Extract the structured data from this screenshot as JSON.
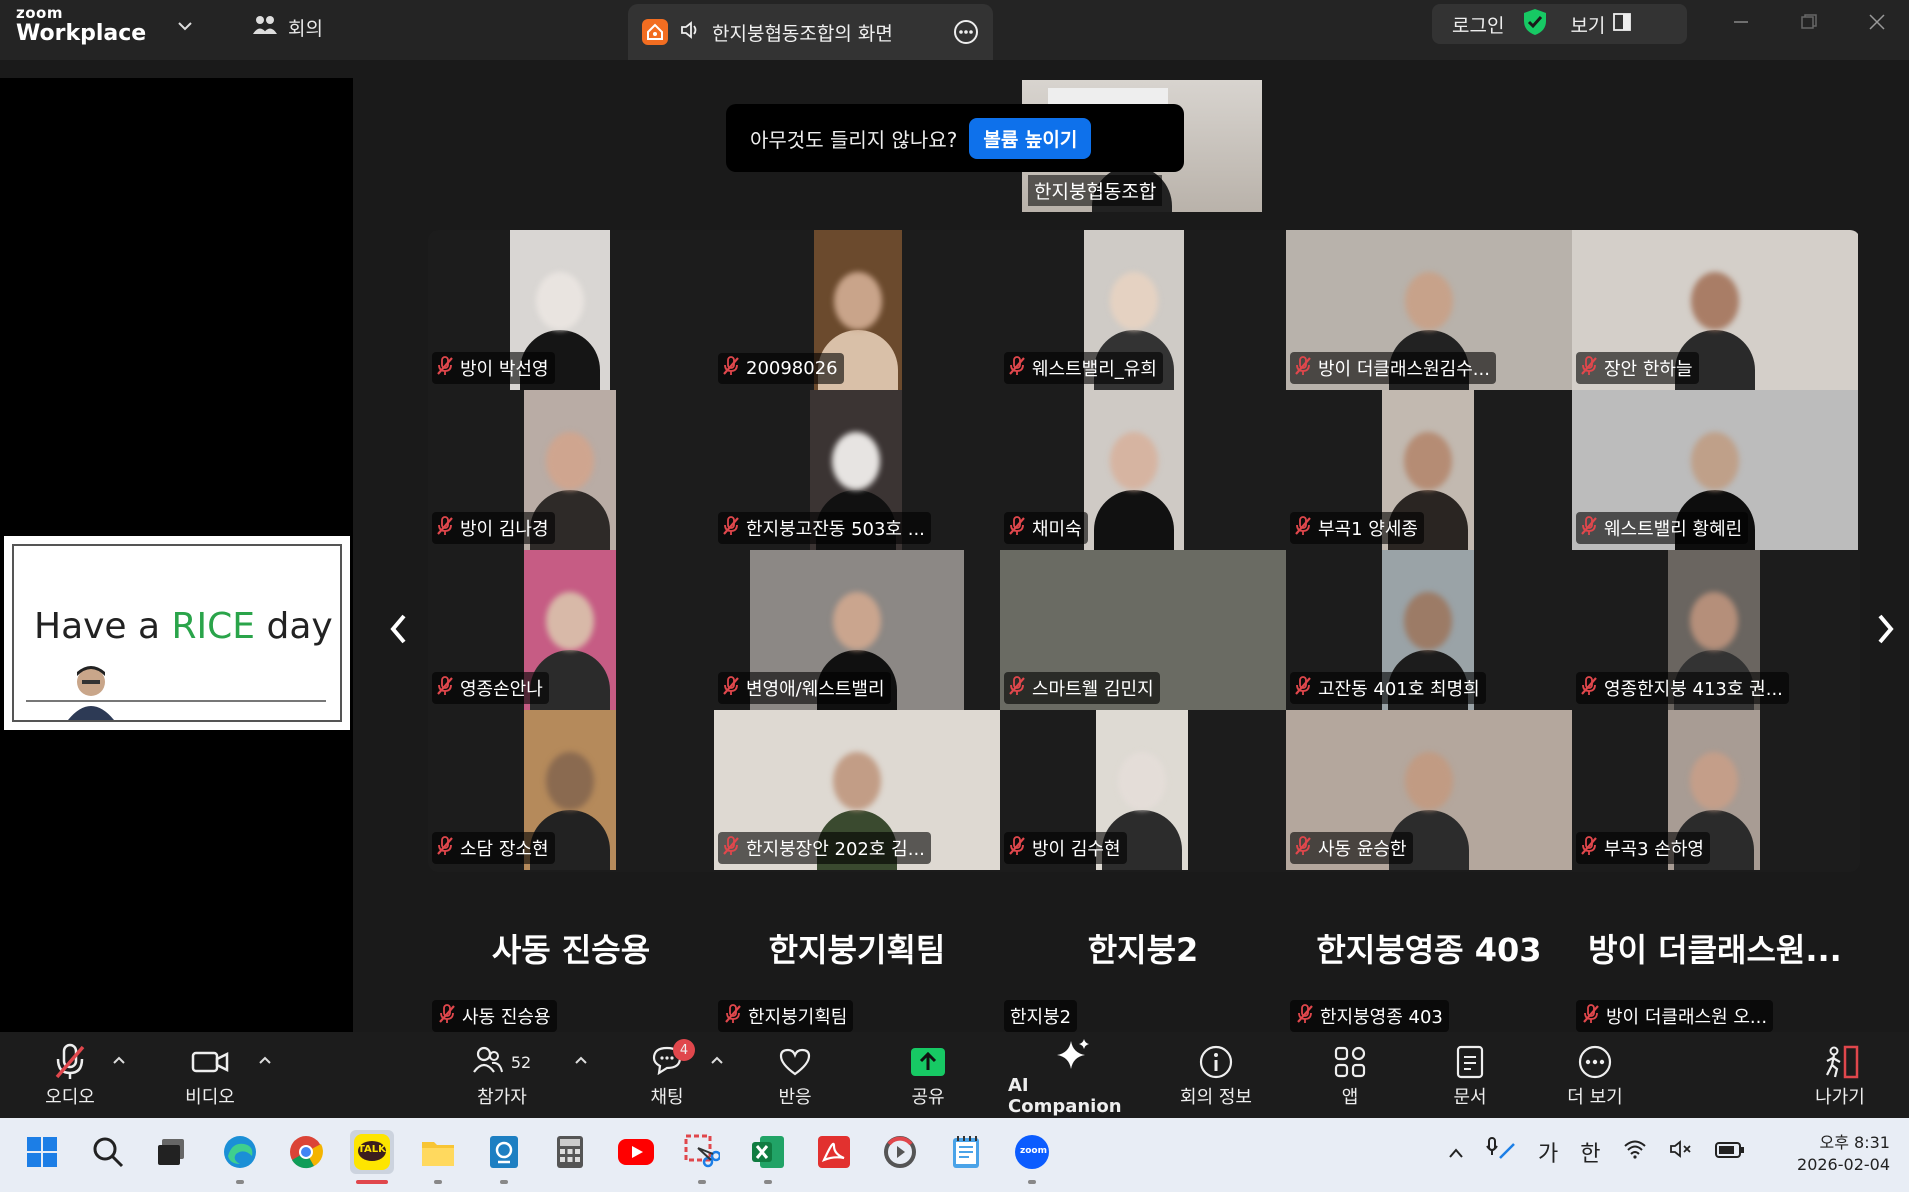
{
  "titlebar": {
    "logo_top": "zoom",
    "logo_bottom": "Workplace",
    "meeting_menu": "회의",
    "share_tab_title": "한지붕협동조합의 화면",
    "login": "로그인",
    "view": "보기"
  },
  "left_panel": {
    "card_text_1": "Have a ",
    "card_text_2": "RICE",
    "card_text_3": " day"
  },
  "notification": {
    "message": "아무것도 들리지 않나요?",
    "button": "볼륨 높이기"
  },
  "host_video": {
    "name": "한지붕협동조합"
  },
  "participants": [
    {
      "name": "방이 박선영"
    },
    {
      "name": "20098026"
    },
    {
      "name": "웨스트밸리_유희"
    },
    {
      "name": "방이 더클래스원김수..."
    },
    {
      "name": "장안 한하늘"
    },
    {
      "name": "방이 김나경"
    },
    {
      "name": "한지붕고잔동 503호 ..."
    },
    {
      "name": "채미숙"
    },
    {
      "name": "부곡1 양세종"
    },
    {
      "name": "웨스트밸리 황혜린"
    },
    {
      "name": "영종손안나"
    },
    {
      "name": "변영애/웨스트밸리"
    },
    {
      "name": "스마트웰 김민지"
    },
    {
      "name": "고잔동 401호 최명희"
    },
    {
      "name": "영종한지붕 413호 권..."
    },
    {
      "name": "소담 장소현"
    },
    {
      "name": "한지붕장안 202호 김..."
    },
    {
      "name": "방이 김수현"
    },
    {
      "name": "사동 윤승한"
    },
    {
      "name": "부곡3 손하영"
    }
  ],
  "no_video_row": [
    {
      "big": "사동 진승용",
      "small": "사동 진승용",
      "muted": true
    },
    {
      "big": "한지붕기획팀",
      "small": "한지붕기획팀",
      "muted": true
    },
    {
      "big": "한지붕2",
      "small": "한지붕2",
      "muted": false
    },
    {
      "big": "한지붕영종 403",
      "small": "한지붕영종 403",
      "muted": true
    },
    {
      "big": "방이 더클래스원...",
      "small": "방이 더클래스원 오...",
      "muted": true
    }
  ],
  "toolbar": {
    "audio": "오디오",
    "video": "비디오",
    "participants": "참가자",
    "participants_count": "52",
    "chat": "채팅",
    "chat_badge": "4",
    "reactions": "반응",
    "share": "공유",
    "ai_companion": "AI Companion",
    "meeting_info": "회의 정보",
    "apps": "앱",
    "docs": "문서",
    "more": "더 보기",
    "leave": "나가기"
  },
  "taskbar": {
    "ime_1": "가",
    "ime_2": "한",
    "time": "오후 8:31",
    "date": "2026-02-04",
    "kakao_label": "TALK",
    "zoom_label": "zoom"
  },
  "colors": {
    "accent_blue": "#0e71eb",
    "share_green": "#17c964",
    "muted_red": "#e0474c",
    "zoom_orange": "#f26d21"
  }
}
